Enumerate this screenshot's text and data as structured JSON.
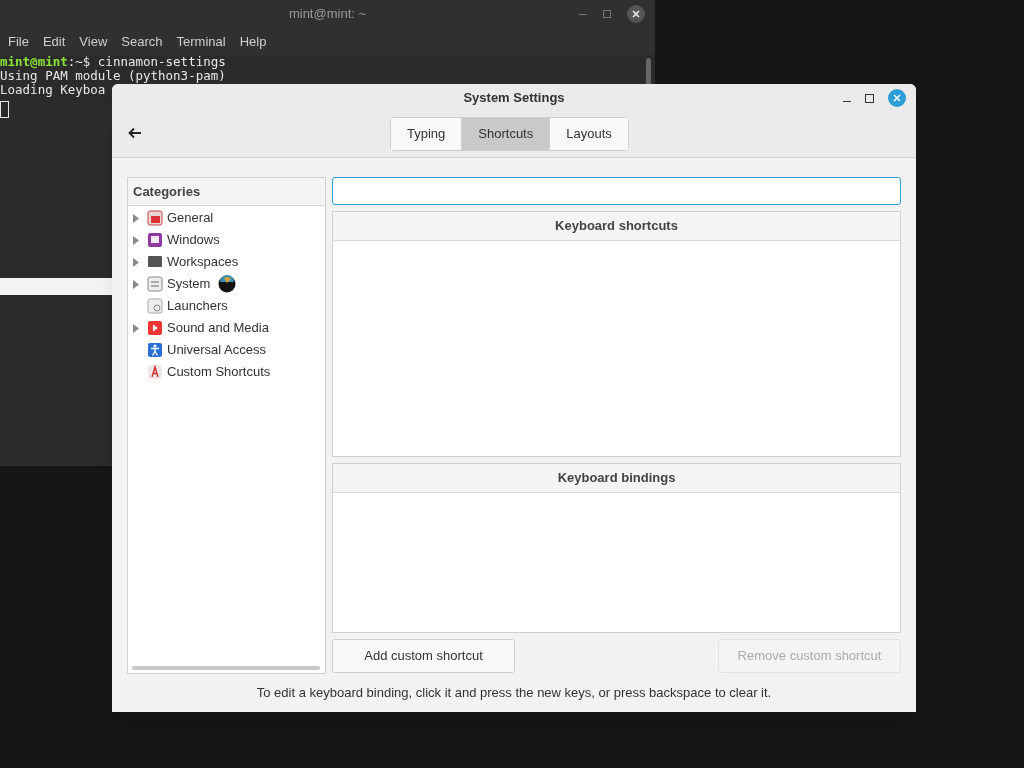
{
  "terminal": {
    "title": "mint@mint: ~",
    "menu": [
      "File",
      "Edit",
      "View",
      "Search",
      "Terminal",
      "Help"
    ],
    "lines": [
      {
        "kind": "prompt",
        "user": "mint@mint",
        "path": ":~$ ",
        "command": "cinnamon-settings"
      },
      {
        "kind": "output",
        "text": "Using PAM module (python3-pam)"
      },
      {
        "kind": "output",
        "text": "Loading Keyboa"
      },
      {
        "kind": "cursor"
      }
    ]
  },
  "settings": {
    "title": "System Settings",
    "tabs": [
      {
        "label": "Typing",
        "selected": false
      },
      {
        "label": "Shortcuts",
        "selected": true
      },
      {
        "label": "Layouts",
        "selected": false
      }
    ],
    "sidebar": {
      "header": "Categories",
      "items": [
        {
          "label": "General",
          "expandable": true
        },
        {
          "label": "Windows",
          "expandable": true
        },
        {
          "label": "Workspaces",
          "expandable": true
        },
        {
          "label": "System",
          "expandable": true
        },
        {
          "label": "Launchers",
          "expandable": false
        },
        {
          "label": "Sound and Media",
          "expandable": true
        },
        {
          "label": "Universal Access",
          "expandable": false
        },
        {
          "label": "Custom Shortcuts",
          "expandable": false
        }
      ]
    },
    "shortcuts_header": "Keyboard shortcuts",
    "bindings_header": "Keyboard bindings",
    "buttons": [
      {
        "label": "Add custom shortcut",
        "disabled": false
      },
      {
        "label": "Remove custom shortcut",
        "disabled": true
      }
    ],
    "hint": "To edit a keyboard binding, click it and press the new keys, or press backspace to clear it."
  }
}
